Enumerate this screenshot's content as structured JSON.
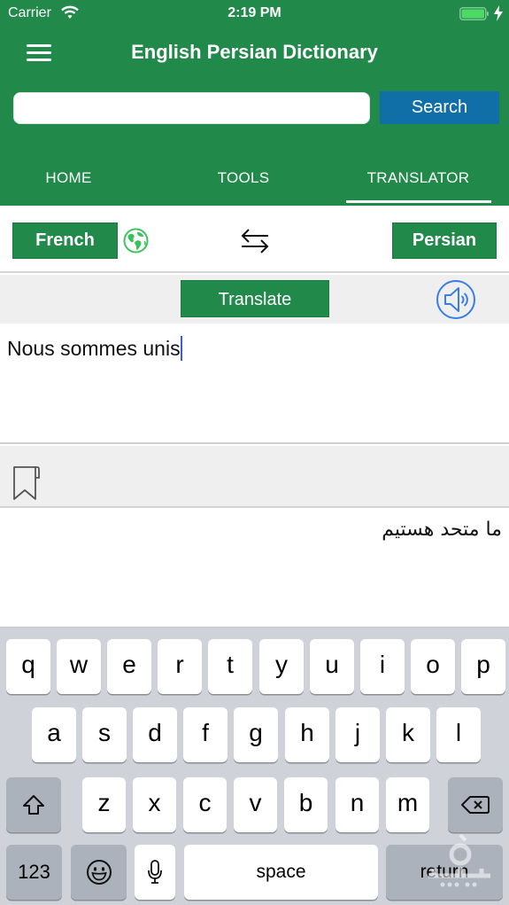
{
  "status_bar": {
    "carrier": "Carrier",
    "time": "2:19 PM",
    "battery_charging": true,
    "icons": [
      "wifi-icon",
      "battery-icon",
      "charging-bolt-icon"
    ]
  },
  "nav": {
    "title": "English Persian Dictionary",
    "menu_icon": "hamburger-menu-icon"
  },
  "search": {
    "value": "",
    "placeholder": "",
    "button_label": "Search"
  },
  "tabs": [
    {
      "label": "HOME",
      "active": false
    },
    {
      "label": "TOOLS",
      "active": false
    },
    {
      "label": "TRANSLATOR",
      "active": true
    }
  ],
  "translator": {
    "source_language": "French",
    "target_language": "Persian",
    "globe_icon": "globe-icon",
    "swap_icon": "swap-arrows-icon",
    "translate_label": "Translate",
    "speaker_icon": "speaker-icon",
    "source_text": "Nous sommes unis",
    "bookmark_icon": "bookmark-icon",
    "result_text": "ما متحد هستیم"
  },
  "keyboard": {
    "row1": [
      "q",
      "w",
      "e",
      "r",
      "t",
      "y",
      "u",
      "i",
      "o",
      "p"
    ],
    "row2": [
      "a",
      "s",
      "d",
      "f",
      "g",
      "h",
      "j",
      "k",
      "l"
    ],
    "row3": [
      "z",
      "x",
      "c",
      "v",
      "b",
      "n",
      "m"
    ],
    "shift_icon": "shift-icon",
    "delete_icon": "delete-icon",
    "numbers_label": "123",
    "emoji_icon": "emoji-icon",
    "mic_icon": "microphone-icon",
    "space_label": "space",
    "return_label": "return"
  },
  "colors": {
    "brand_green": "#21894a",
    "search_blue": "#116fa8",
    "caret_blue": "#3b5ddb",
    "speaker_blue": "#3b7de6",
    "globe_green": "#3ac25a"
  }
}
